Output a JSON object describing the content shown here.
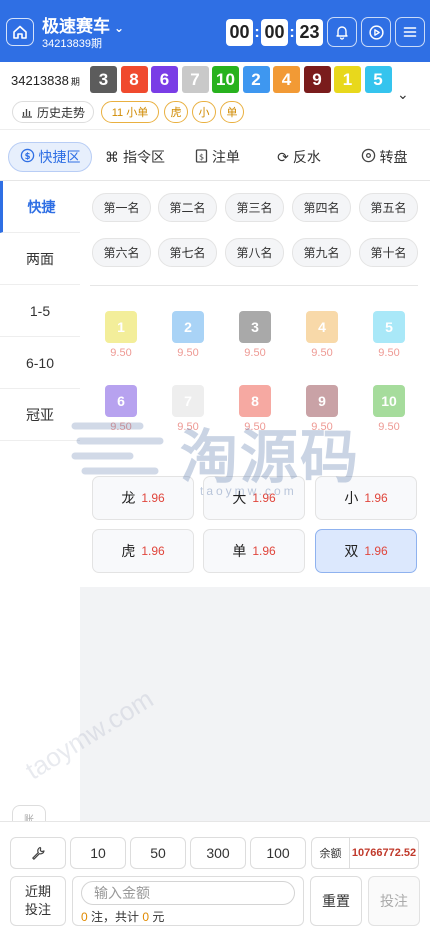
{
  "header": {
    "title": "极速赛车",
    "subtitle": "34213839期",
    "timer": [
      "00",
      "00",
      "23"
    ],
    "icons": [
      "home-icon",
      "bell-icon",
      "play-circle-icon",
      "menu-icon"
    ]
  },
  "result": {
    "issue": "34213838",
    "issue_suffix": "期",
    "balls": [
      {
        "n": "3",
        "color": "#5c5c5c"
      },
      {
        "n": "8",
        "color": "#f04a2e"
      },
      {
        "n": "6",
        "color": "#7a3de6"
      },
      {
        "n": "7",
        "color": "#c9c9c9"
      },
      {
        "n": "10",
        "color": "#28b21e"
      },
      {
        "n": "2",
        "color": "#3e97f0"
      },
      {
        "n": "4",
        "color": "#f29a35"
      },
      {
        "n": "9",
        "color": "#7a1c1c"
      },
      {
        "n": "1",
        "color": "#e8d81c"
      },
      {
        "n": "5",
        "color": "#35c4ee"
      }
    ],
    "history_label": "历史走势",
    "tags": [
      "11 小单",
      "虎",
      "小",
      "单"
    ]
  },
  "tabs": [
    {
      "label": "快捷区",
      "icon": "dollar-circle-icon",
      "active": true
    },
    {
      "label": "指令区",
      "icon": "command-icon"
    },
    {
      "label": "注单",
      "icon": "receipt-icon"
    },
    {
      "label": "反水",
      "icon": "refresh-icon"
    },
    {
      "label": "转盘",
      "icon": "wheel-icon"
    }
  ],
  "sidebar": [
    "快捷",
    "两面",
    "1-5",
    "6-10",
    "冠亚"
  ],
  "positions": [
    "第一名",
    "第二名",
    "第三名",
    "第四名",
    "第五名",
    "第六名",
    "第七名",
    "第八名",
    "第九名",
    "第十名"
  ],
  "numbers": [
    {
      "n": "1",
      "odds": "9.50",
      "color": "#f3ee9a"
    },
    {
      "n": "2",
      "odds": "9.50",
      "color": "#a9d3f6"
    },
    {
      "n": "3",
      "odds": "9.50",
      "color": "#a9a9a9"
    },
    {
      "n": "4",
      "odds": "9.50",
      "color": "#f8d9a9"
    },
    {
      "n": "5",
      "odds": "9.50",
      "color": "#a9e8f8"
    },
    {
      "n": "6",
      "odds": "9.50",
      "color": "#b7a2ef"
    },
    {
      "n": "7",
      "odds": "9.50",
      "color": "#eeeeee"
    },
    {
      "n": "8",
      "odds": "9.50",
      "color": "#f6a9a2"
    },
    {
      "n": "9",
      "odds": "9.50",
      "color": "#c9a2a6"
    },
    {
      "n": "10",
      "odds": "9.50",
      "color": "#a6dc9c"
    }
  ],
  "quick_bets": [
    {
      "label": "龙",
      "odds": "1.96"
    },
    {
      "label": "大",
      "odds": "1.96"
    },
    {
      "label": "小",
      "odds": "1.96"
    },
    {
      "label": "虎",
      "odds": "1.96"
    },
    {
      "label": "单",
      "odds": "1.96"
    },
    {
      "label": "双",
      "odds": "1.96",
      "selected": true
    }
  ],
  "watermark": {
    "text": "淘源码",
    "url": "taoymw.com",
    "diag": "taoymw.com"
  },
  "bottom": {
    "chips": [
      "10",
      "50",
      "300",
      "100"
    ],
    "balance_label": "余额",
    "balance_value": "10766772.52",
    "recent_label_1": "近期",
    "recent_label_2": "投注",
    "amount_placeholder": "输入金额",
    "count": "0",
    "count_suffix": "注，共计",
    "total": "0",
    "total_suffix": "元",
    "reset_label": "重置",
    "submit_label": "投注",
    "float_label": "账"
  }
}
